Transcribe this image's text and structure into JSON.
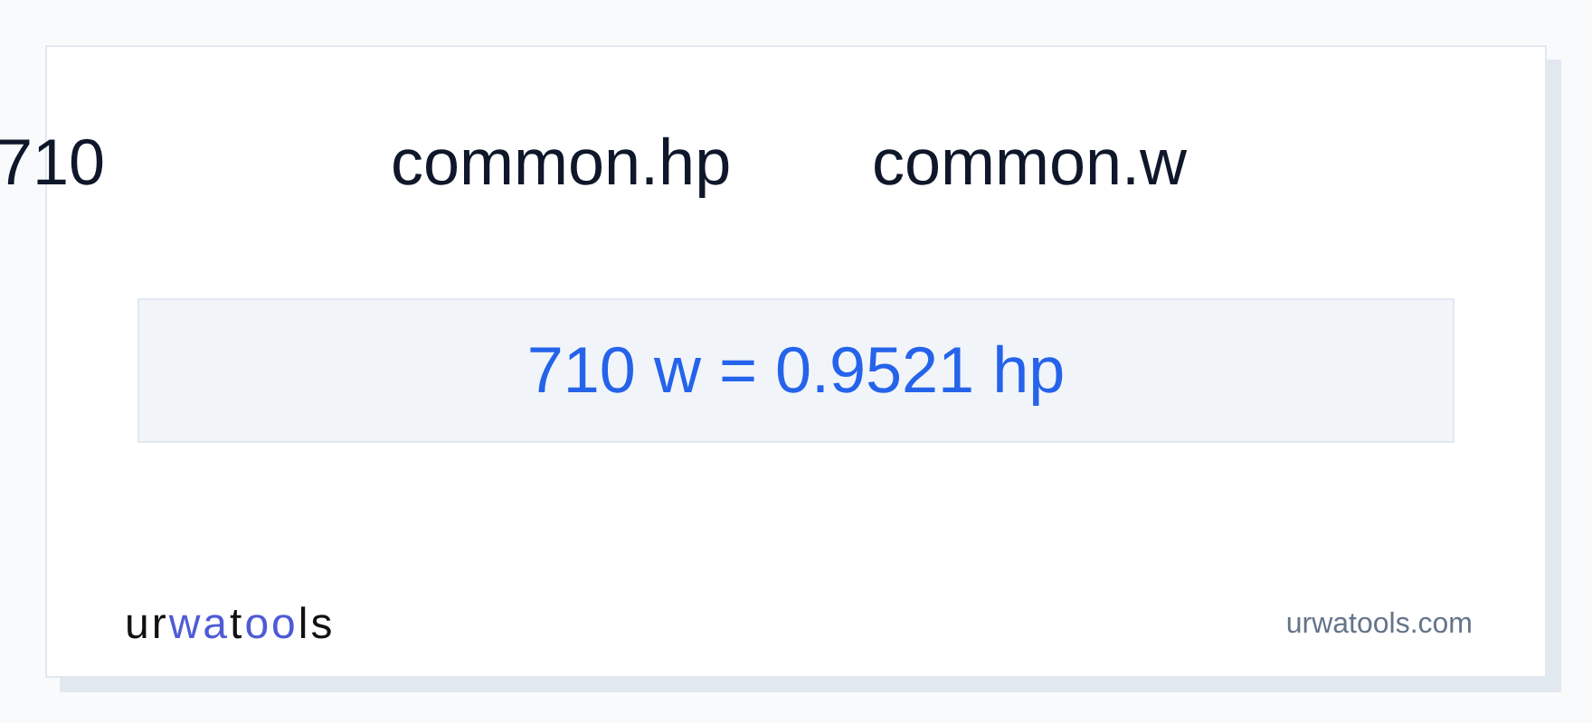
{
  "header": [
    "710",
    "common.hp",
    "common.w"
  ],
  "result": "710 w = 0.9521 hp",
  "logo": [
    {
      "text": "ur",
      "accent": false
    },
    {
      "text": "wa",
      "accent": true
    },
    {
      "text": "t",
      "accent": false
    },
    {
      "text": "oo",
      "accent": true
    },
    {
      "text": "ls",
      "accent": false
    }
  ],
  "site": "urwatools.com"
}
